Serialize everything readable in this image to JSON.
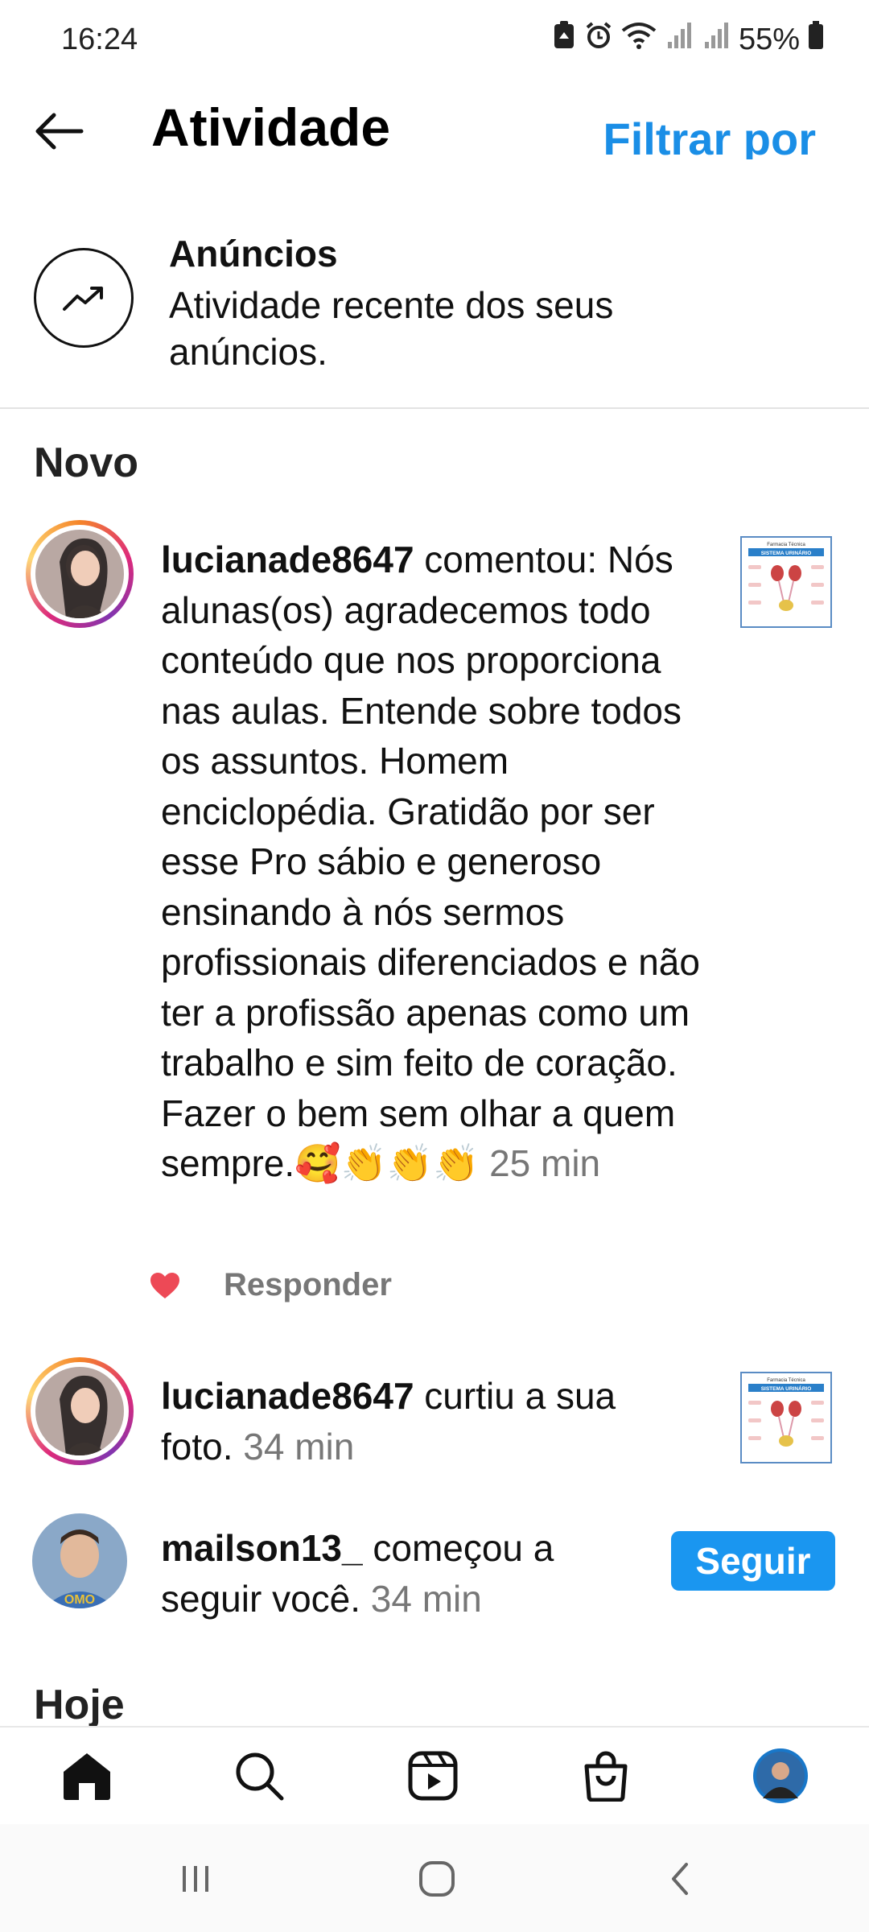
{
  "status_bar": {
    "time": "16:24",
    "battery": "55%"
  },
  "header": {
    "title": "Atividade",
    "filter_label": "Filtrar por"
  },
  "ads": {
    "title": "Anúncios",
    "description": "Atividade recente dos seus anúncios."
  },
  "sections": {
    "new": "Novo",
    "today": "Hoje"
  },
  "notifications": [
    {
      "username": "lucianade8647",
      "text": " comentou: Nós alunas(os) agradecemos todo conteúdo que nos proporciona nas aulas. Entende sobre todos os assuntos. Homem enciclopédia. Gratidão por ser esse Pro sábio e generoso ensinando à nós sermos profissionais diferenciados e não ter a profissão apenas como um trabalho e sim feito de coração. Fazer o bem sem olhar a quem sempre.🥰👏👏👏",
      "time": "25 min",
      "reply_label": "Responder"
    },
    {
      "username": "lucianade8647",
      "text": " curtiu a sua foto.",
      "time": "34 min"
    },
    {
      "username": "mailson13_",
      "text": " começou a seguir você.",
      "time": "34 min",
      "follow_label": "Seguir"
    }
  ],
  "thumbnail": {
    "heading": "Farmacia Técnica",
    "banner": "SISTEMA URINÁRIO"
  },
  "colors": {
    "accent": "#1a96f0",
    "heart": "#ed4956",
    "muted": "#777777"
  },
  "icons": {
    "nav": [
      "home-icon",
      "search-icon",
      "reels-icon",
      "shop-icon",
      "profile-avatar"
    ],
    "system": [
      "recents-icon",
      "home-circle-icon",
      "back-chevron-icon"
    ]
  }
}
